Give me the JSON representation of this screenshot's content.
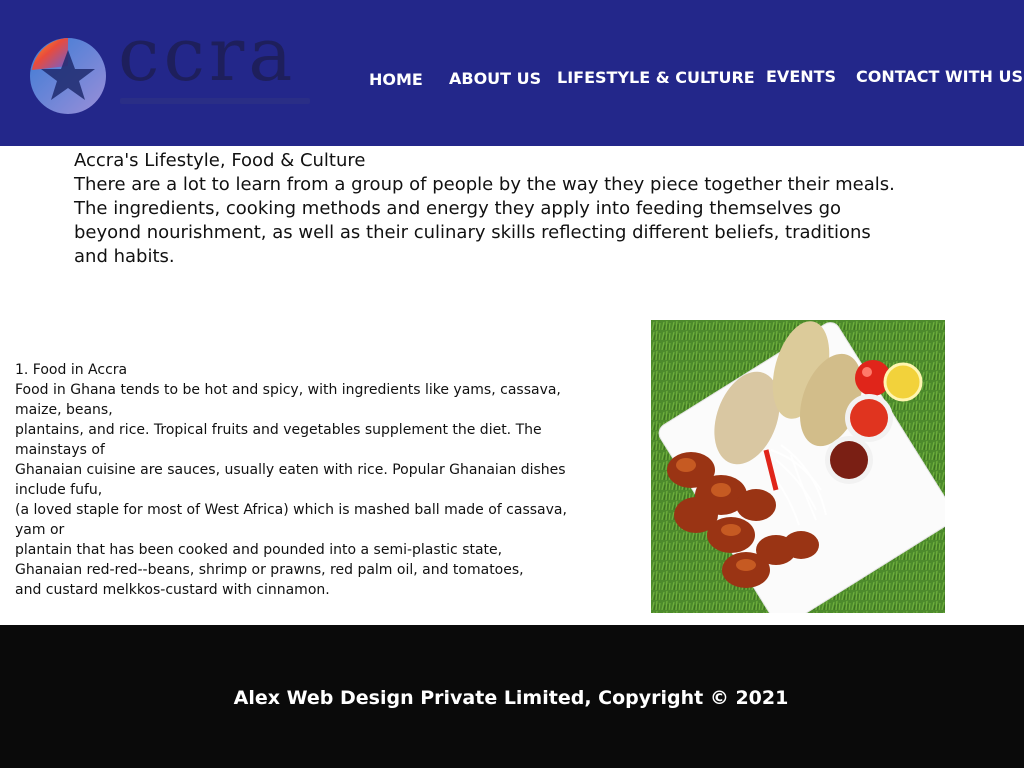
{
  "header": {
    "logo_text": "ccra",
    "background_color": "#23278a"
  },
  "nav": {
    "items": [
      {
        "label": "HOME"
      },
      {
        "label": "ABOUT US"
      },
      {
        "label": "LIFESTYLE & CULTURE"
      },
      {
        "label": "EVENTS"
      },
      {
        "label": "CONTACT WITH US"
      }
    ]
  },
  "intro": {
    "title": "Accra's Lifestyle, Food & Culture",
    "paragraph1": "There are a lot to learn from a group of people by the way they piece together their meals.",
    "paragraph2": "The ingredients, cooking methods and energy they apply into feeding themselves go beyond nourishment, as well as their culinary skills reflecting different beliefs, traditions and habits."
  },
  "food_section": {
    "lines": [
      "1. Food in Accra",
      "Food in Ghana tends to be hot and spicy, with ingredients like yams, cassava, maize, beans,",
      "plantains, and rice. Tropical fruits and vegetables supplement the diet. The mainstays of",
      "Ghanaian cuisine are sauces, usually eaten with rice. Popular Ghanaian dishes include fufu,",
      "(a loved staple for most of West Africa) which is mashed ball made of cassava, yam or",
      "plantain that has been cooked and pounded into a semi-plastic state,",
      "Ghanaian red-red--beans, shrimp or prawns, red palm oil, and tomatoes,",
      "and custard melkkos-custard with cinnamon."
    ]
  },
  "footer": {
    "text": "Alex Web Design Private Limited, Copyright © 2021",
    "background_color": "#0a0a0a"
  }
}
